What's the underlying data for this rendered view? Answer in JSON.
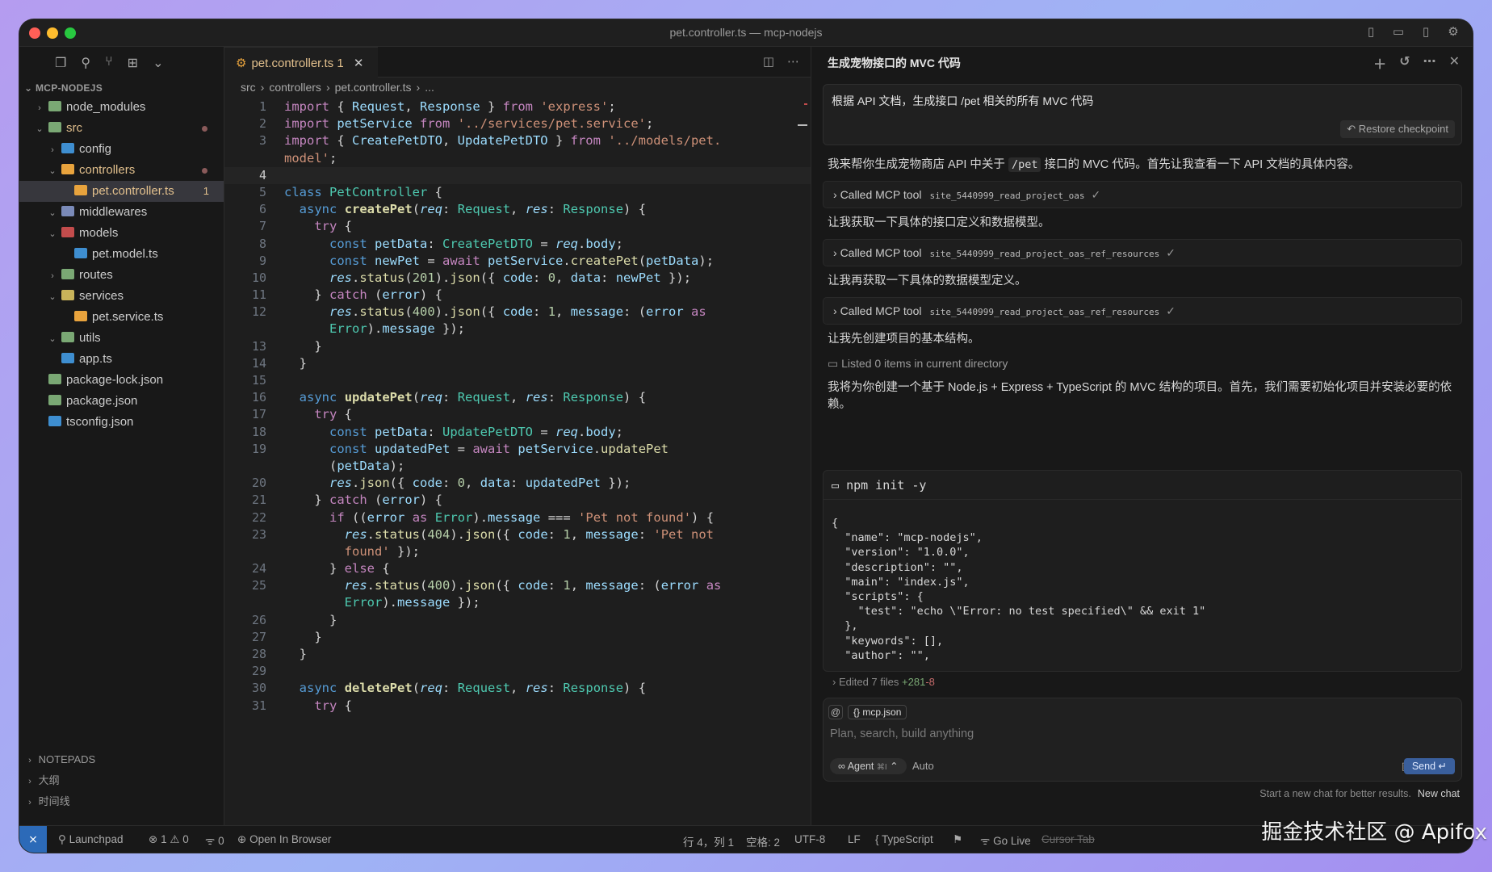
{
  "window": {
    "title": "pet.controller.ts — mcp-nodejs"
  },
  "sidebar": {
    "project": "MCP-NODEJS",
    "tree": [
      {
        "label": "node_modules",
        "level": 0,
        "chev": "right",
        "color": "#7aa874"
      },
      {
        "label": "src",
        "level": 0,
        "chev": "down",
        "color": "#7aa874",
        "mod": true,
        "dot": true
      },
      {
        "label": "config",
        "level": 1,
        "chev": "right",
        "color": "#3e8ed0"
      },
      {
        "label": "controllers",
        "level": 1,
        "chev": "down",
        "color": "#e8a33d",
        "mod": true,
        "dot": true
      },
      {
        "label": "pet.controller.ts",
        "level": 2,
        "chev": "",
        "color": "#e8a33d",
        "mod": true,
        "active": true,
        "badge": "1"
      },
      {
        "label": "middlewares",
        "level": 1,
        "chev": "down",
        "color": "#7a8ab8"
      },
      {
        "label": "models",
        "level": 1,
        "chev": "down",
        "color": "#c34c4c"
      },
      {
        "label": "pet.model.ts",
        "level": 2,
        "chev": "",
        "color": "#3e8ed0"
      },
      {
        "label": "routes",
        "level": 1,
        "chev": "right",
        "color": "#7aa874"
      },
      {
        "label": "services",
        "level": 1,
        "chev": "down",
        "color": "#c9b45a"
      },
      {
        "label": "pet.service.ts",
        "level": 2,
        "chev": "",
        "color": "#e8a33d"
      },
      {
        "label": "utils",
        "level": 1,
        "chev": "down",
        "color": "#7aa874"
      },
      {
        "label": "app.ts",
        "level": 1,
        "chev": "",
        "color": "#3e8ed0"
      },
      {
        "label": "package-lock.json",
        "level": 0,
        "chev": "",
        "color": "#7aa874"
      },
      {
        "label": "package.json",
        "level": 0,
        "chev": "",
        "color": "#7aa874"
      },
      {
        "label": "tsconfig.json",
        "level": 0,
        "chev": "",
        "color": "#3e8ed0"
      }
    ],
    "bottom": [
      "NOTEPADS",
      "大纲",
      "时间线"
    ]
  },
  "editor": {
    "tab": {
      "label": "pet.controller.ts",
      "badge": "1"
    },
    "breadcrumb": [
      "src",
      "controllers",
      "pet.controller.ts",
      "..."
    ],
    "lines": [
      {
        "n": "1",
        "html": "<span class='k'>import</span> { <span class='v'>Request</span>, <span class='v'>Response</span> } <span class='k'>from</span> <span class='s'>'express'</span>;"
      },
      {
        "n": "2",
        "html": "<span class='k'>import</span> <span class='v'>petService</span> <span class='k'>from</span> <span class='s'>'../services/pet.service'</span>;"
      },
      {
        "n": "3",
        "html": "<span class='k'>import</span> { <span class='v'>CreatePetDTO</span>, <span class='v'>UpdatePetDTO</span> } <span class='k'>from</span> <span class='s'>'../models/pet.</span>"
      },
      {
        "n": "",
        "html": "<span class='s'>model'</span>;"
      },
      {
        "n": "4",
        "html": "",
        "cur": true
      },
      {
        "n": "5",
        "html": "<span class='kb'>class</span> <span class='ty'>PetController</span> {"
      },
      {
        "n": "6",
        "html": "  <span class='kb'>async</span> <span class='fn-b'>createPet</span>(<span class='it'>req</span>: <span class='ty'>Request</span>, <span class='it'>res</span>: <span class='ty'>Response</span>) {"
      },
      {
        "n": "7",
        "html": "    <span class='k'>try</span> {"
      },
      {
        "n": "8",
        "html": "      <span class='kb'>const</span> <span class='v'>petData</span>: <span class='ty'>CreatePetDTO</span> = <span class='it'>req</span>.<span class='v'>body</span>;"
      },
      {
        "n": "9",
        "html": "      <span class='kb'>const</span> <span class='v'>newPet</span> = <span class='k'>await</span> <span class='v'>petService</span>.<span class='f'>createPet</span>(<span class='v'>petData</span>);"
      },
      {
        "n": "10",
        "html": "      <span class='it'>res</span>.<span class='f'>status</span>(<span class='n'>201</span>).<span class='f'>json</span>({ <span class='v'>code</span>: <span class='n'>0</span>, <span class='v'>data</span>: <span class='v'>newPet</span> });"
      },
      {
        "n": "11",
        "html": "    } <span class='k'>catch</span> (<span class='v'>error</span>) {"
      },
      {
        "n": "12",
        "html": "      <span class='it'>res</span>.<span class='f'>status</span>(<span class='n'>400</span>).<span class='f'>json</span>({ <span class='v'>code</span>: <span class='n'>1</span>, <span class='v'>message</span>: (<span class='v'>error</span> <span class='k'>as</span>"
      },
      {
        "n": "",
        "html": "      <span class='ty'>Error</span>).<span class='v'>message</span> });"
      },
      {
        "n": "13",
        "html": "    }"
      },
      {
        "n": "14",
        "html": "  }"
      },
      {
        "n": "15",
        "html": ""
      },
      {
        "n": "16",
        "html": "  <span class='kb'>async</span> <span class='fn-b'>updatePet</span>(<span class='it'>req</span>: <span class='ty'>Request</span>, <span class='it'>res</span>: <span class='ty'>Response</span>) {"
      },
      {
        "n": "17",
        "html": "    <span class='k'>try</span> {"
      },
      {
        "n": "18",
        "html": "      <span class='kb'>const</span> <span class='v'>petData</span>: <span class='ty'>UpdatePetDTO</span> = <span class='it'>req</span>.<span class='v'>body</span>;"
      },
      {
        "n": "19",
        "html": "      <span class='kb'>const</span> <span class='v'>updatedPet</span> = <span class='k'>await</span> <span class='v'>petService</span>.<span class='f'>updatePet</span>"
      },
      {
        "n": "",
        "html": "      (<span class='v'>petData</span>);"
      },
      {
        "n": "20",
        "html": "      <span class='it'>res</span>.<span class='f'>json</span>({ <span class='v'>code</span>: <span class='n'>0</span>, <span class='v'>data</span>: <span class='v'>updatedPet</span> });"
      },
      {
        "n": "21",
        "html": "    } <span class='k'>catch</span> (<span class='v'>error</span>) {"
      },
      {
        "n": "22",
        "html": "      <span class='k'>if</span> ((<span class='v'>error</span> <span class='k'>as</span> <span class='ty'>Error</span>).<span class='v'>message</span> === <span class='s'>'Pet not found'</span>) {"
      },
      {
        "n": "23",
        "html": "        <span class='it'>res</span>.<span class='f'>status</span>(<span class='n'>404</span>).<span class='f'>json</span>({ <span class='v'>code</span>: <span class='n'>1</span>, <span class='v'>message</span>: <span class='s'>'Pet not</span>"
      },
      {
        "n": "",
        "html": "        <span class='s'>found'</span> });"
      },
      {
        "n": "24",
        "html": "      } <span class='k'>else</span> {"
      },
      {
        "n": "25",
        "html": "        <span class='it'>res</span>.<span class='f'>status</span>(<span class='n'>400</span>).<span class='f'>json</span>({ <span class='v'>code</span>: <span class='n'>1</span>, <span class='v'>message</span>: (<span class='v'>error</span> <span class='k'>as</span>"
      },
      {
        "n": "",
        "html": "        <span class='ty'>Error</span>).<span class='v'>message</span> });"
      },
      {
        "n": "26",
        "html": "      }"
      },
      {
        "n": "27",
        "html": "    }"
      },
      {
        "n": "28",
        "html": "  }"
      },
      {
        "n": "29",
        "html": ""
      },
      {
        "n": "30",
        "html": "  <span class='kb'>async</span> <span class='fn-b'>deletePet</span>(<span class='it'>req</span>: <span class='ty'>Request</span>, <span class='it'>res</span>: <span class='ty'>Response</span>) {"
      },
      {
        "n": "31",
        "html": "    <span class='k'>try</span> {"
      }
    ]
  },
  "chat": {
    "title": "生成宠物接口的 MVC 代码",
    "prompt": "根据 API 文档，生成接口 /pet 相关的所有 MVC 代码",
    "restore": "Restore checkpoint",
    "msg1_pre": "我来帮你生成宠物商店 API 中关于",
    "msg1_code": "/pet",
    "msg1_post": "接口的 MVC 代码。首先让我查看一下 API 文档的具体内容。",
    "tool_label": "Called MCP tool",
    "tool1": "site_5440999_read_project_oas",
    "msg2": "让我获取一下具体的接口定义和数据模型。",
    "tool2": "site_5440999_read_project_oas_ref_resources",
    "msg3": "让我再获取一下具体的数据模型定义。",
    "tool3": "site_5440999_read_project_oas_ref_resources",
    "msg4": "让我先创建项目的基本结构。",
    "listed": "Listed 0 items in current directory",
    "msg5": "我将为你创建一个基于 Node.js + Express + TypeScript 的 MVC 结构的项目。首先，我们需要初始化项目并安装必要的依赖。",
    "terminal_cmd": "npm init -y",
    "terminal_output": "{\n  \"name\": \"mcp-nodejs\",\n  \"version\": \"1.0.0\",\n  \"description\": \"\",\n  \"main\": \"index.js\",\n  \"scripts\": {\n    \"test\": \"echo \\\"Error: no test specified\\\" && exit 1\"\n  },\n  \"keywords\": [],\n  \"author\": \"\",",
    "edited_label": "Edited 7 files",
    "edited_add": "+281",
    "edited_del": "-8",
    "context_file": "mcp.json",
    "placeholder": "Plan, search, build anything",
    "agent": "Agent",
    "agent_key": "⌘I",
    "auto": "Auto",
    "send": "Send",
    "foot_text": "Start a new chat for better results.",
    "foot_link": "New chat"
  },
  "statusbar": {
    "launchpad": "Launchpad",
    "errors": "1",
    "warnings": "0",
    "ports": "0",
    "open_browser": "Open In Browser",
    "position": "行 4，列 1",
    "spaces": "空格: 2",
    "encoding": "UTF-8",
    "eol": "LF",
    "language": "TypeScript",
    "golive": "Go Live",
    "cursor_tab": "Cursor Tab"
  },
  "watermark": "掘金技术社区 @ Apifox"
}
